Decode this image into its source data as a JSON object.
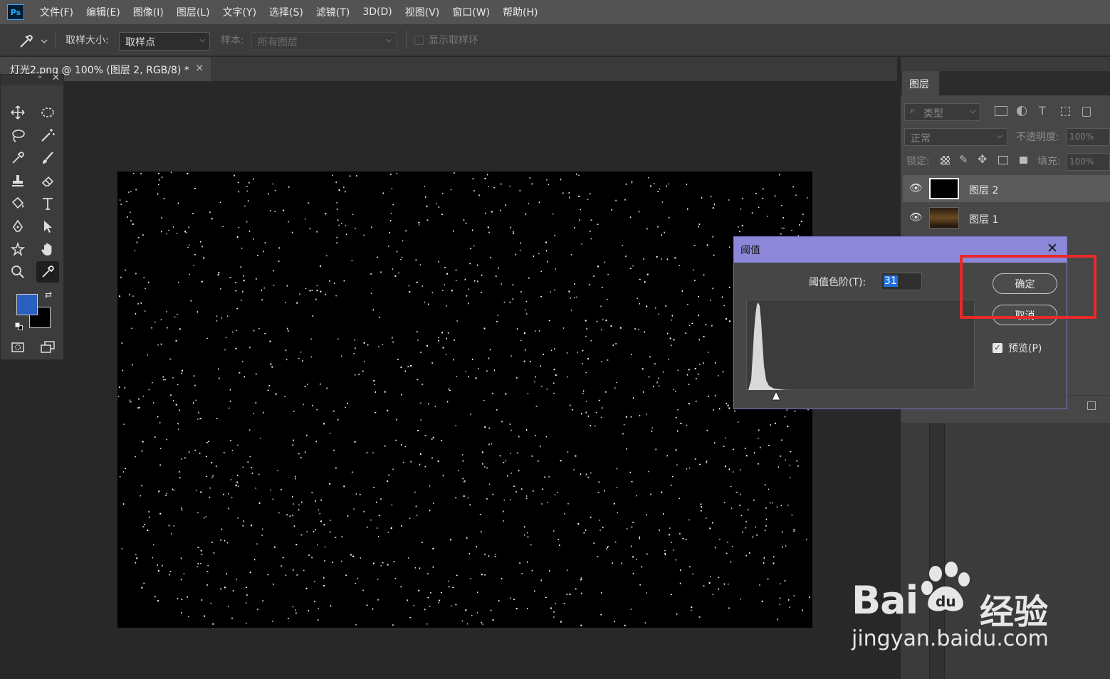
{
  "app": {
    "logo_text": "Ps"
  },
  "menu": [
    "文件(F)",
    "编辑(E)",
    "图像(I)",
    "图层(L)",
    "文字(Y)",
    "选择(S)",
    "滤镜(T)",
    "3D(D)",
    "视图(V)",
    "窗口(W)",
    "帮助(H)"
  ],
  "options_bar": {
    "sample_size_label": "取样大小:",
    "sample_size_value": "取样点",
    "sample_label": "样本:",
    "sample_value": "所有图层",
    "show_ring_label": "显示取样环"
  },
  "document_tab": {
    "title": "灯光2.png @ 100% (图层 2, RGB/8) *",
    "close": "×"
  },
  "colors": {
    "foreground": "#2a5fbf",
    "background": "#000000",
    "accent": "#8d87d9",
    "highlight": "#e62a2a"
  },
  "layers_panel": {
    "tab_label": "图层",
    "filter_kind": "类型",
    "blend_mode": "正常",
    "opacity_label": "不透明度:",
    "opacity_value": "100%",
    "lock_label": "锁定:",
    "fill_label": "填充:",
    "fill_value": "100%",
    "layers": [
      {
        "name": "图层 2",
        "selected": true
      },
      {
        "name": "图层 1",
        "selected": false
      }
    ]
  },
  "threshold_dialog": {
    "title": "阈值",
    "close": "✕",
    "level_label": "阈值色阶(T):",
    "level_value": "31",
    "ok_label": "确定",
    "cancel_label": "取消",
    "preview_label": "预览(P)",
    "preview_checked": true
  },
  "watermark": {
    "brand_left": "Bai",
    "brand_right": "经验",
    "url": "jingyan.baidu.com"
  }
}
